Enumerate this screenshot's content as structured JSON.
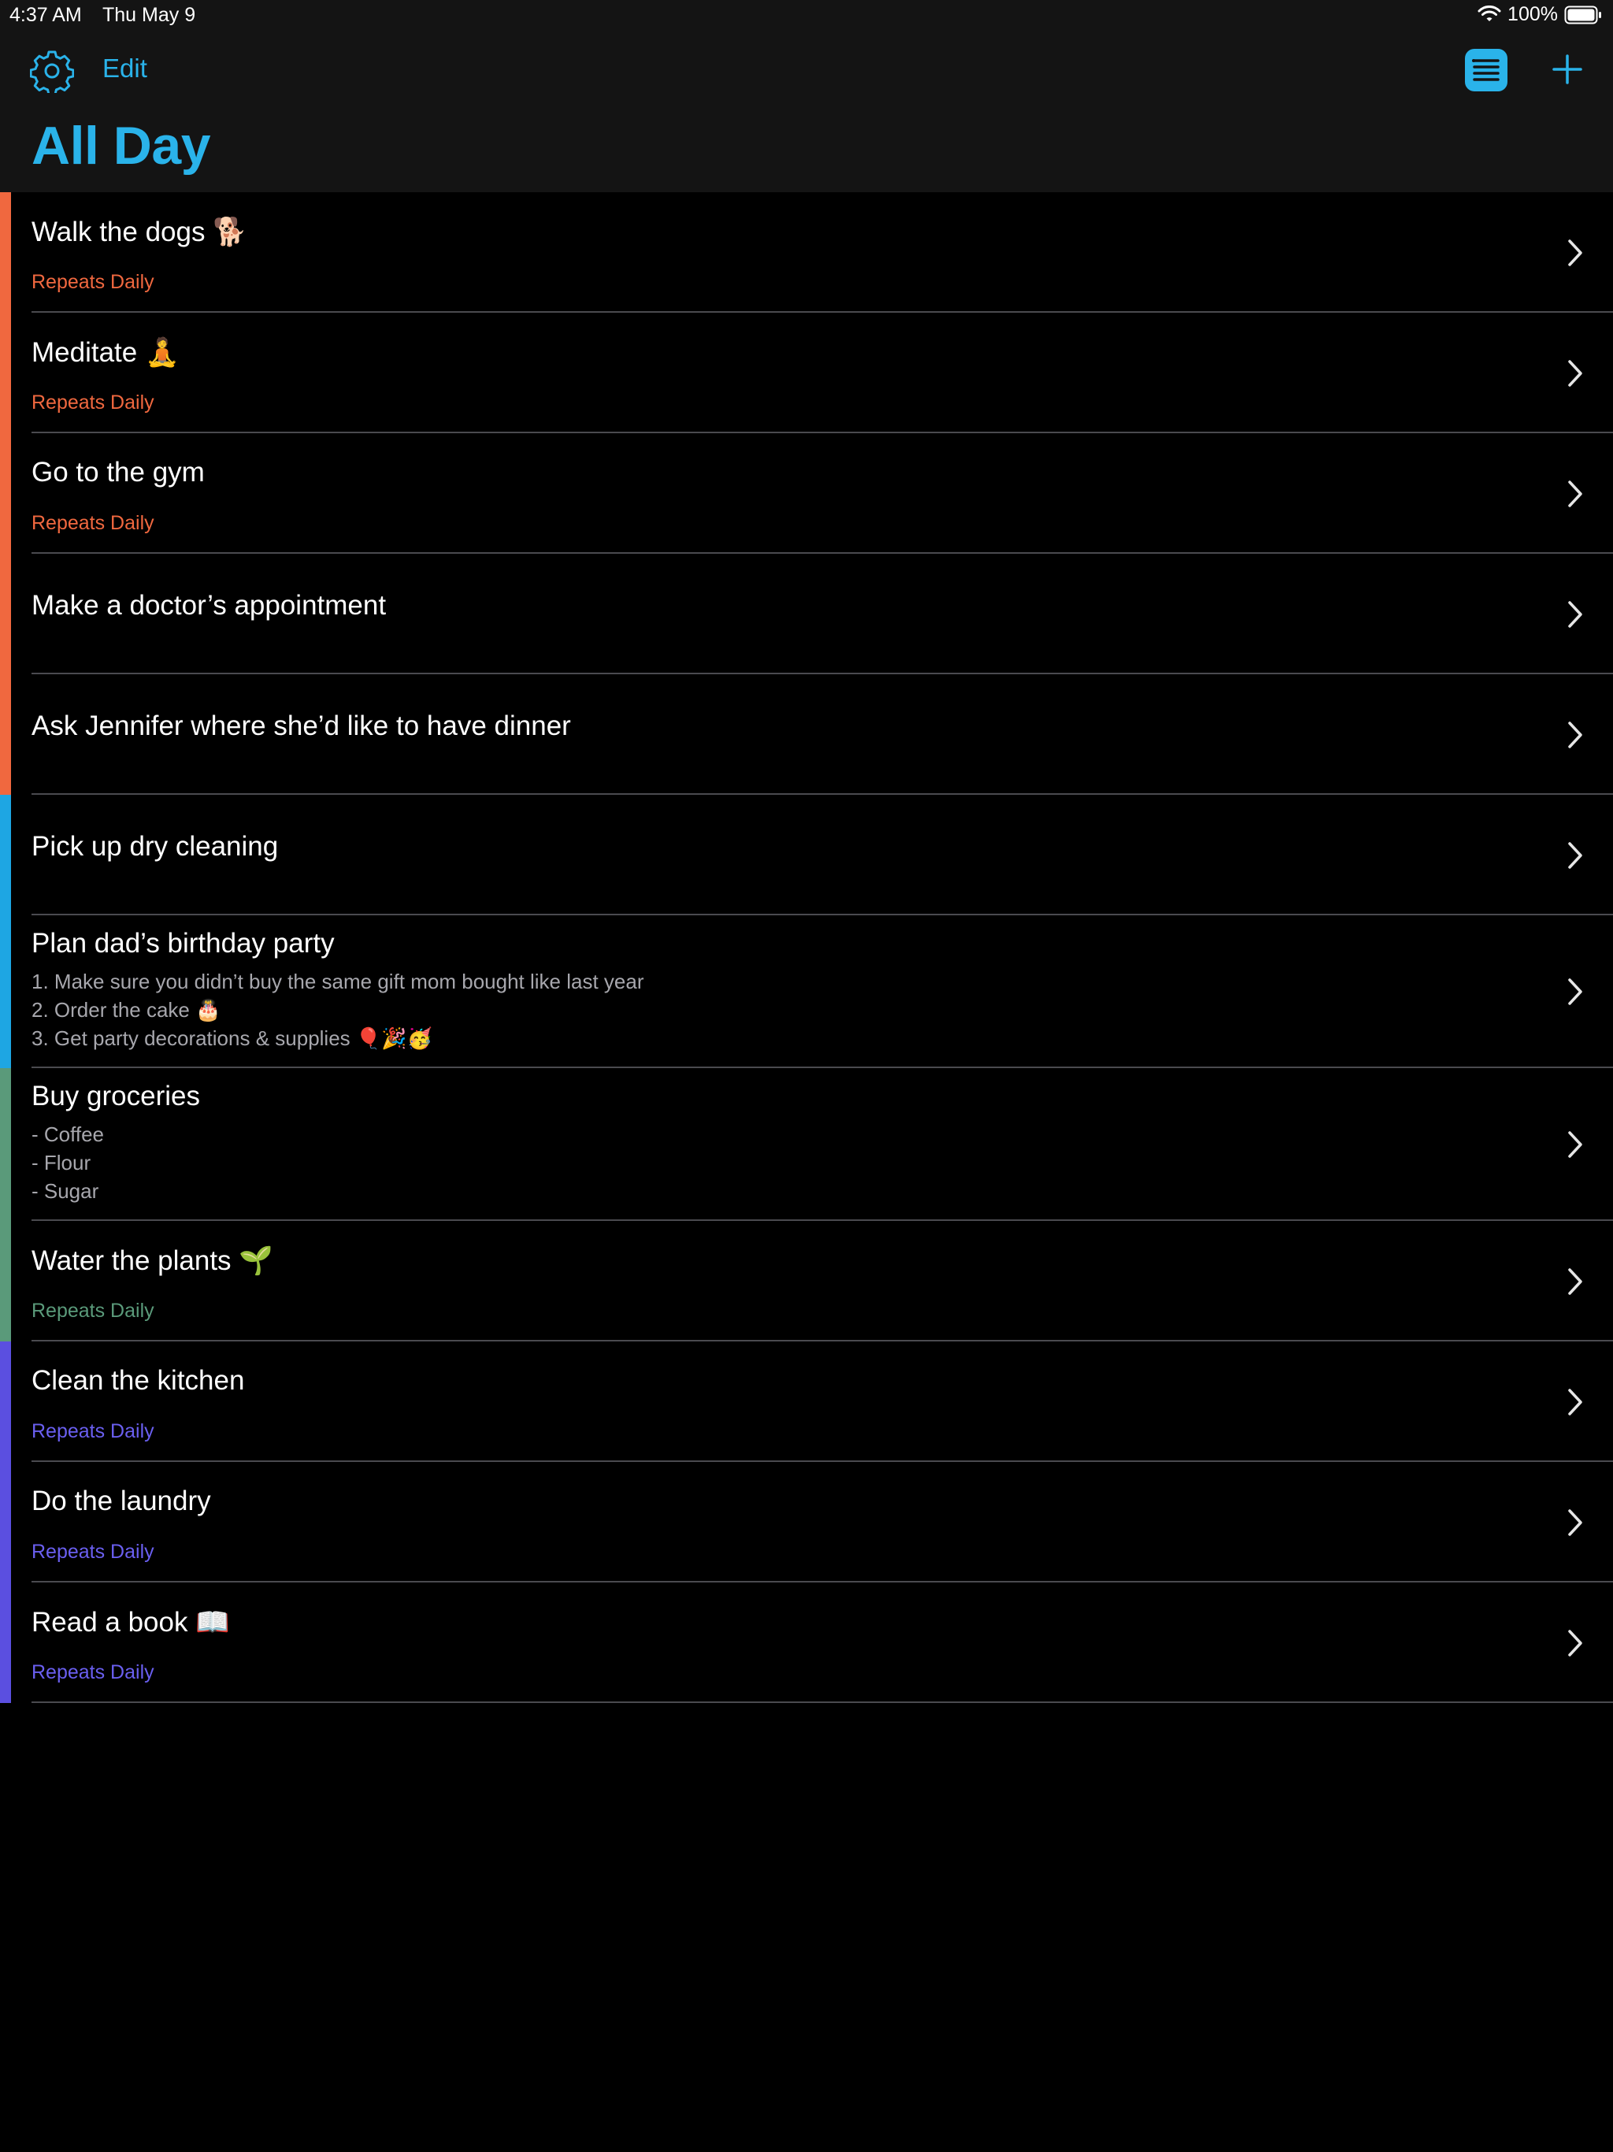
{
  "status_bar": {
    "time": "4:37 AM",
    "date": "Thu May 9",
    "battery": "100%"
  },
  "header": {
    "edit_label": "Edit",
    "title": "All Day",
    "accent_color": "#2ab3ea"
  },
  "icons": [
    "gear-icon",
    "edit-button",
    "list-view-icon",
    "plus-icon",
    "chevron-right-icon",
    "wifi-icon",
    "battery-icon"
  ],
  "tasks": [
    {
      "title": "Walk the dogs 🐕",
      "subtitle": "Repeats Daily",
      "notes": [],
      "color": "#f0683f",
      "subcolor": "#f0683f"
    },
    {
      "title": "Meditate 🧘",
      "subtitle": "Repeats Daily",
      "notes": [],
      "color": "#f0683f",
      "subcolor": "#f0683f"
    },
    {
      "title": "Go to the gym",
      "subtitle": "Repeats Daily",
      "notes": [],
      "color": "#f0683f",
      "subcolor": "#f0683f"
    },
    {
      "title": "Make a doctor’s appointment",
      "subtitle": "",
      "notes": [],
      "color": "#f0683f",
      "subcolor": "#f0683f"
    },
    {
      "title": "Ask Jennifer where she’d like to have dinner",
      "subtitle": "",
      "notes": [],
      "color": "#f0683f",
      "subcolor": "#f0683f"
    },
    {
      "title": "Pick up dry cleaning",
      "subtitle": "",
      "notes": [],
      "color": "#1ea6e3",
      "subcolor": "#1ea6e3"
    },
    {
      "title": "Plan dad’s birthday party",
      "subtitle": "",
      "notes": [
        "1. Make sure you didn’t buy the same gift mom bought like last year",
        "2. Order the cake 🎂",
        "3. Get party decorations & supplies 🎈🎉🥳"
      ],
      "color": "#1ea6e3",
      "subcolor": "#1ea6e3"
    },
    {
      "title": "Buy groceries",
      "subtitle": "",
      "notes": [
        "- Coffee",
        "- Flour",
        "- Sugar"
      ],
      "color": "#5a9a7a",
      "subcolor": "#5a9a7a"
    },
    {
      "title": "Water the plants 🌱",
      "subtitle": "Repeats Daily",
      "notes": [],
      "color": "#5a9a7a",
      "subcolor": "#5a9a7a"
    },
    {
      "title": "Clean the kitchen",
      "subtitle": "Repeats Daily",
      "notes": [],
      "color": "#5b4fe0",
      "subcolor": "#6a5ff0"
    },
    {
      "title": "Do the laundry",
      "subtitle": "Repeats Daily",
      "notes": [],
      "color": "#5b4fe0",
      "subcolor": "#6a5ff0"
    },
    {
      "title": "Read a book 📖",
      "subtitle": "Repeats Daily",
      "notes": [],
      "color": "#5b4fe0",
      "subcolor": "#6a5ff0"
    }
  ]
}
